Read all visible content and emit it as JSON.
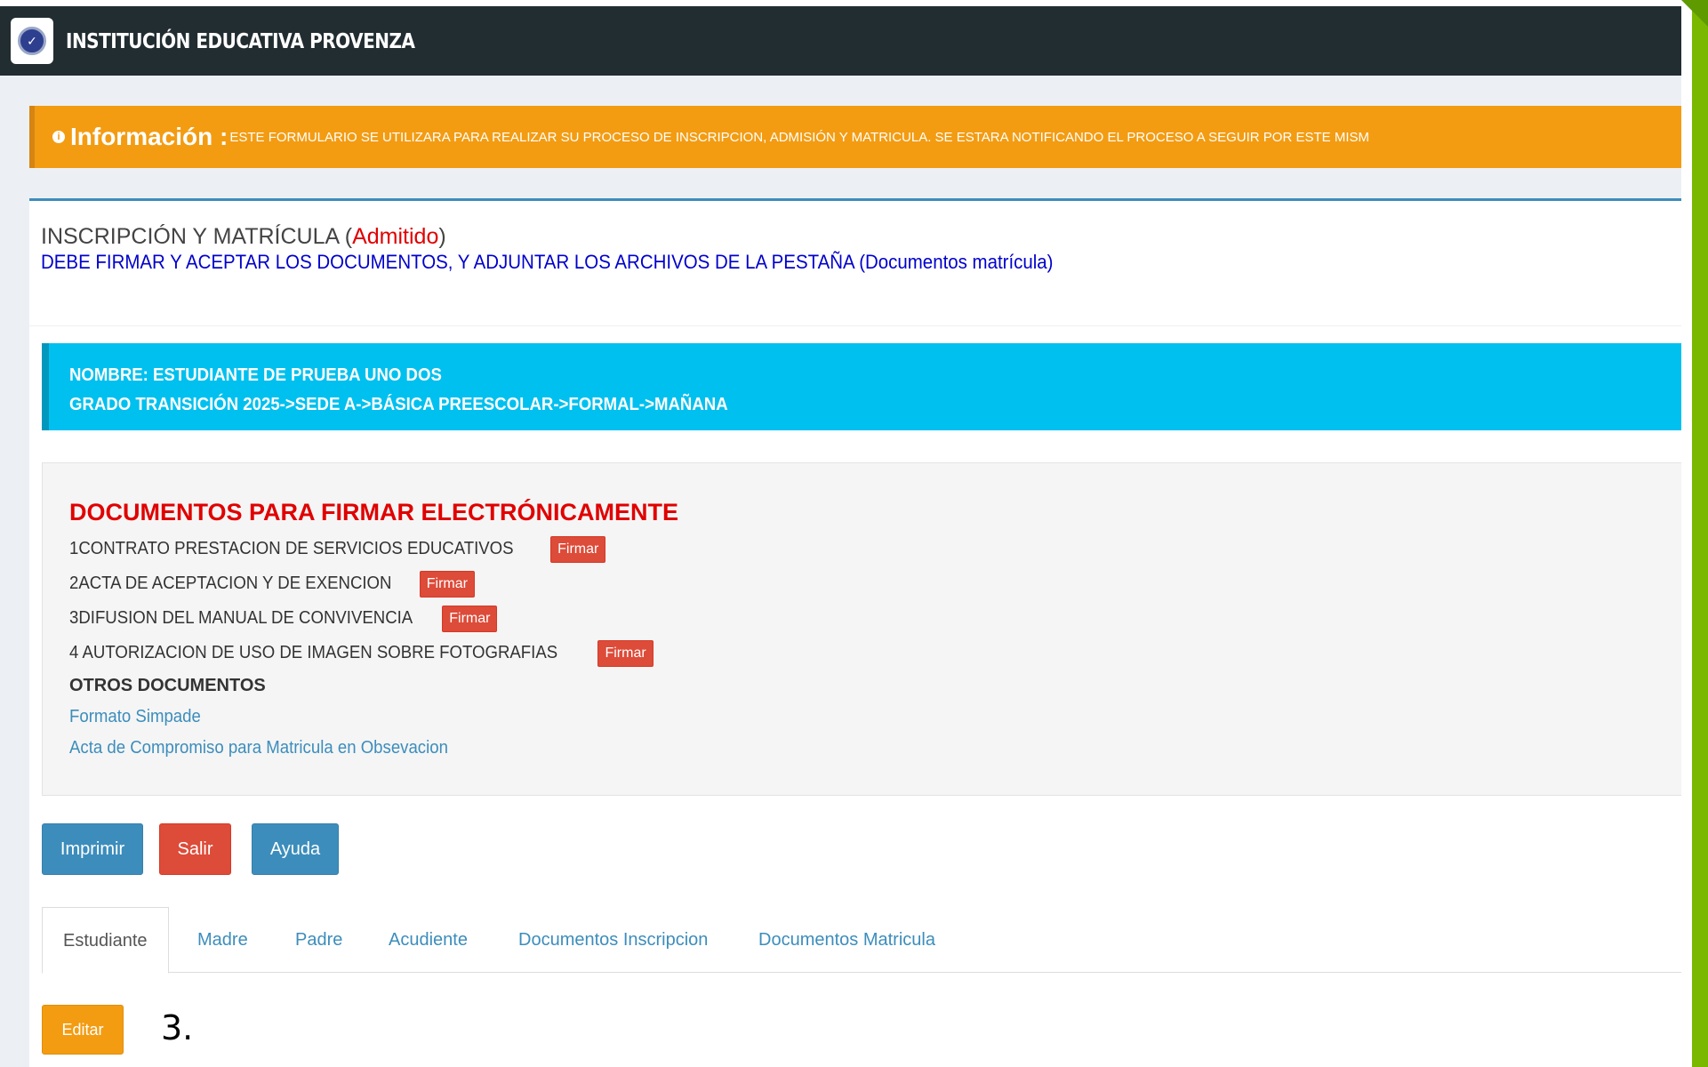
{
  "header": {
    "school_name": "INSTITUCIÓN EDUCATIVA PROVENZA"
  },
  "info": {
    "title": "Información :",
    "text": "ESTE FORMULARIO SE UTILIZARA PARA REALIZAR SU PROCESO DE INSCRIPCION, ADMISIÓN Y MATRICULA. SE ESTARA NOTIFICANDO EL PROCESO A SEGUIR POR ESTE MISM"
  },
  "form": {
    "title": "INSCRIPCIÓN Y MATRÍCULA",
    "status": "Admitido",
    "instruction": "DEBE FIRMAR Y ACEPTAR LOS DOCUMENTOS, Y ADJUNTAR LOS ARCHIVOS DE LA PESTAÑA (Documentos matrícula)"
  },
  "student": {
    "name_line": "NOMBRE: ESTUDIANTE DE PRUEBA UNO DOS",
    "grade_line": "GRADO TRANSICIÓN 2025->SEDE A->BÁSICA PREESCOLAR->FORMAL->MAÑANA"
  },
  "documents": {
    "title": "DOCUMENTOS PARA FIRMAR ELECTRÓNICAMENTE",
    "sign_label": "Firmar",
    "items": [
      {
        "label": "1CONTRATO PRESTACION DE SERVICIOS EDUCATIVOS"
      },
      {
        "label": "2ACTA DE ACEPTACION Y DE EXENCION"
      },
      {
        "label": "3DIFUSION DEL MANUAL DE CONVIVENCIA"
      },
      {
        "label": "4 AUTORIZACION DE USO DE IMAGEN SOBRE FOTOGRAFIAS"
      }
    ],
    "others_title": "OTROS DOCUMENTOS",
    "other_links": [
      {
        "label": "Formato Simpade"
      },
      {
        "label": "Acta de Compromiso para Matricula en Obsevacion"
      }
    ]
  },
  "actions": {
    "print": "Imprimir",
    "exit": "Salir",
    "help": "Ayuda",
    "edit": "Editar"
  },
  "tabs": [
    {
      "label": "Estudiante",
      "active": true
    },
    {
      "label": "Madre"
    },
    {
      "label": "Padre"
    },
    {
      "label": "Acudiente"
    },
    {
      "label": "Documentos Inscripcion"
    },
    {
      "label": "Documentos Matricula"
    }
  ],
  "annotation": "3.",
  "colors": {
    "topbar": "#222d32",
    "info": "#f39c12",
    "callout": "#00c0ef",
    "danger": "#dd4b39",
    "primary": "#3c8dbc",
    "deco_green": "#7ab800"
  }
}
